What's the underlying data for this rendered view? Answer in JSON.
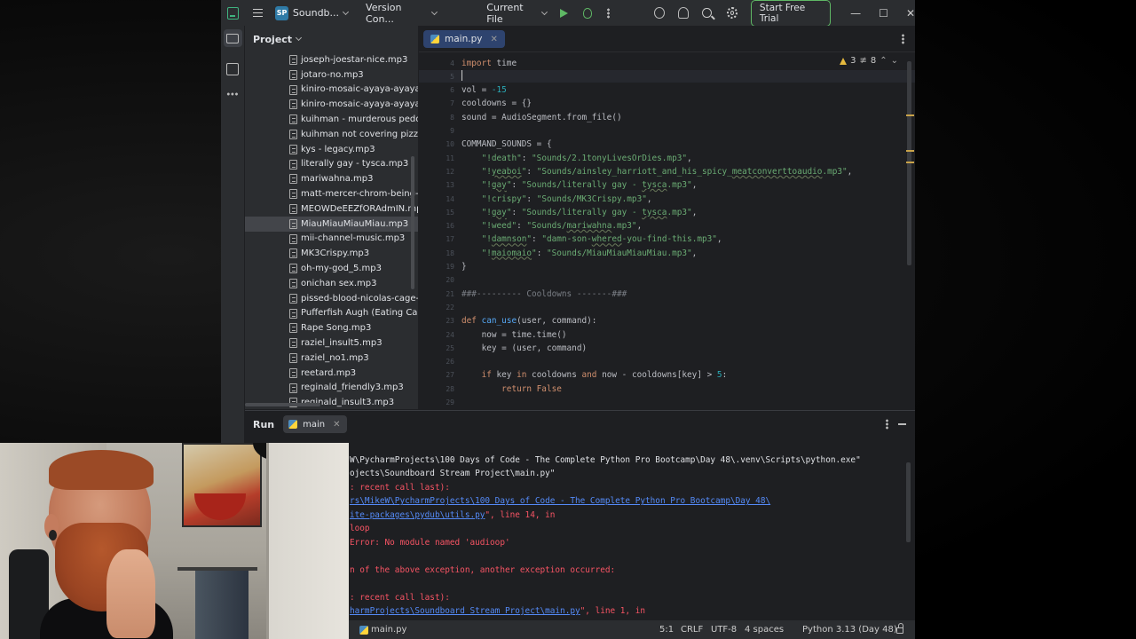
{
  "titlebar": {
    "project_badge": "SP",
    "project_name": "Soundb...",
    "vcs": "Version Con...",
    "run_config": "Current File",
    "trial_button": "Start Free Trial",
    "minimize": "—",
    "maximize": "☐",
    "close": "✕"
  },
  "project": {
    "title": "Project",
    "files": [
      "joseph-joestar-nice.mp3",
      "jotaro-no.mp3",
      "kiniro-mosaic-ayaya-ayaya-ay",
      "kiniro-mosaic-ayaya-ayaya_Hc",
      "kuihman - murderous pedoph",
      "kuihman not covering pizza cl",
      "kys - legacy.mp3",
      "literally gay - tysca.mp3",
      "mariwahna.mp3",
      "matt-mercer-chrom-being-he",
      "MEOWDeEEZfORAdmIN.mp3",
      "MiauMiauMiauMiau.mp3",
      "mii-channel-music.mp3",
      "MK3Crispy.mp3",
      "oh-my-god_5.mp3",
      "onichan sex.mp3",
      "pissed-blood-nicolas-cage-be",
      "Pufferfish Augh (Eating Carrot",
      "Rape Song.mp3",
      "raziel_insult5.mp3",
      "raziel_no1.mp3",
      "reetard.mp3",
      "reginald_friendly3.mp3",
      "reginald_insult3.mp3"
    ],
    "selected_index": 11
  },
  "editor": {
    "tab_label": "main.py",
    "warnings": "3",
    "weak_warnings": "8",
    "lines": [
      {
        "n": "4",
        "html": "<span class=\"kw\">import</span> time"
      },
      {
        "n": "5",
        "html": ""
      },
      {
        "n": "6",
        "html": "vol = <span class=\"num\">-15</span>"
      },
      {
        "n": "7",
        "html": "cooldowns = {}"
      },
      {
        "n": "8",
        "html": "sound = AudioSegment.from_file()"
      },
      {
        "n": "9",
        "html": ""
      },
      {
        "n": "10",
        "html": "COMMAND_SOUNDS = {"
      },
      {
        "n": "11",
        "html": "    <span class=\"str\">\"!death\"</span>: <span class=\"str\">\"Sounds/2.1tonyLivesOrDies.mp3\"</span>,"
      },
      {
        "n": "12",
        "html": "    <span class=\"str\">\"!<span class=\"ul\">yeaboi</span>\"</span>: <span class=\"str\">\"Sounds/ainsley_harriott_and_his_spicy_<span class=\"ul\">meatconverttoaudio</span>.mp3\"</span>,"
      },
      {
        "n": "13",
        "html": "    <span class=\"str\">\"!<span class=\"ul\">gay</span>\"</span>: <span class=\"str\">\"Sounds/literally gay - <span class=\"ul\">tysca</span>.mp3\"</span>,"
      },
      {
        "n": "14",
        "html": "    <span class=\"str\">\"!crispy\"</span>: <span class=\"str\">\"Sounds/MK3Crispy.mp3\"</span>,"
      },
      {
        "n": "15",
        "html": "    <span class=\"str\">\"!<span class=\"ul\">gay</span>\"</span>: <span class=\"str\">\"Sounds/literally gay - <span class=\"ul\">tysca</span>.mp3\"</span>,"
      },
      {
        "n": "16",
        "html": "    <span class=\"str\">\"!weed\"</span>: <span class=\"str\">\"Sounds/<span class=\"ul\">mariwahna</span>.mp3\"</span>,"
      },
      {
        "n": "17",
        "html": "    <span class=\"str\">\"!<span class=\"ul\">damnson</span>\"</span>: <span class=\"str\">\"damn-son-<span class=\"ul\">whered</span>-you-find-this.mp3\"</span>,"
      },
      {
        "n": "18",
        "html": "    <span class=\"str\">\"!<span class=\"ul\">maiomaio</span>\"</span>: <span class=\"str\">\"Sounds/MiauMiauMiauMiau.mp3\"</span>,"
      },
      {
        "n": "19",
        "html": "}"
      },
      {
        "n": "20",
        "html": ""
      },
      {
        "n": "21",
        "html": "<span class=\"cmt\">###--------- Cooldowns -------###</span>"
      },
      {
        "n": "22",
        "html": ""
      },
      {
        "n": "23",
        "html": "<span class=\"kw\">def</span> <span class=\"fn\">can_use</span>(user, command):"
      },
      {
        "n": "24",
        "html": "    now = time.time()"
      },
      {
        "n": "25",
        "html": "    key = (user, command)"
      },
      {
        "n": "26",
        "html": ""
      },
      {
        "n": "27",
        "html": "    <span class=\"kw\">if</span> key <span class=\"kw\">in</span> cooldowns <span class=\"kw\">and</span> now - cooldowns[key] > <span class=\"num\">5</span>:"
      },
      {
        "n": "28",
        "html": "        <span class=\"kw\">return False</span>"
      },
      {
        "n": "29",
        "html": ""
      }
    ]
  },
  "run": {
    "title": "Run",
    "tab_label": "main",
    "console": [
      {
        "cls": "c-norm",
        "text": "W\\PycharmProjects\\100 Days of Code - The Complete Python Pro Bootcamp\\Day 48\\.venv\\Scripts\\python.exe\""
      },
      {
        "cls": "c-norm",
        "text": "ojects\\Soundboard Stream Project\\main.py\""
      },
      {
        "cls": "c-err",
        "text": ": recent call last):"
      },
      {
        "cls": "c-link",
        "text": "rs\\MikeW\\PycharmProjects\\100 Days of Code - The Complete Python Pro Bootcamp\\Day 48\\"
      },
      {
        "cls": "c-err",
        "text": "<span class=\"c-link\">ite-packages\\pydub\\utils.py</span>\", line 14, in <module>"
      },
      {
        "cls": "c-err",
        "text": "loop"
      },
      {
        "cls": "c-err",
        "text": "Error: No module named 'audioop'"
      },
      {
        "cls": "c-err",
        "text": ""
      },
      {
        "cls": "c-err",
        "text": "n of the above exception, another exception occurred:"
      },
      {
        "cls": "c-err",
        "text": ""
      },
      {
        "cls": "c-err",
        "text": ": recent call last):"
      },
      {
        "cls": "c-err",
        "text": "<span class=\"c-link\">harmProjects\\Soundboard Stream Project\\main.py</span>\", line 1, in <module>"
      }
    ]
  },
  "statusbar": {
    "file": "main.py",
    "position": "5:1",
    "line_sep": "CRLF",
    "encoding": "UTF-8",
    "indent": "4 spaces",
    "interpreter": "Python 3.13 (Day 48)"
  }
}
